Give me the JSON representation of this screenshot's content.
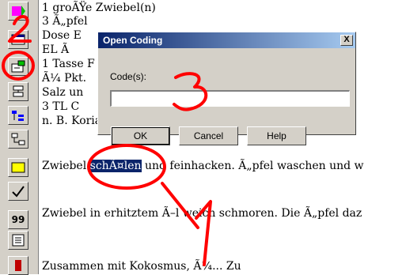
{
  "toolbar": {
    "icons": [
      "arrow-icon",
      "panel-icon",
      "open-coding-icon",
      "link-icon",
      "code-tree-icon",
      "network-icon",
      "memo-icon",
      "check-icon",
      "number-99-icon",
      "list-icon",
      "bookmark-icon"
    ],
    "label_99": "99"
  },
  "document": {
    "lines": [
      "1 groÃŸe   Zwiebel(n)",
      "3   Ã„pfel",
      " Dose  E",
      " EL   Ã",
      "1 Tasse F",
      "Ã¼ Pkt.",
      "   Salz un",
      "3 TL    C",
      " n. B.  KoriandergrÃ¼n"
    ],
    "para1_before": " Zwiebel ",
    "para1_selected": "schÃ¤len",
    "para1_after": " und feinhacken. Ã„pfel waschen und w",
    "para2": "Zwiebel in erhitztem Ã–l weich schmoren. Die Ã„pfel daz",
    "para3": "Zusammen mit Kokosmus, Ã¼... Zu"
  },
  "dialog": {
    "title": "Open Coding",
    "close_label": "X",
    "codes_label": "Code(s):",
    "code_input_value": "",
    "ok_label": "OK",
    "cancel_label": "Cancel",
    "help_label": "Help"
  },
  "annotations": {
    "number_1": "1",
    "number_2": "2",
    "number_3": "3",
    "color": "#ff0000"
  }
}
